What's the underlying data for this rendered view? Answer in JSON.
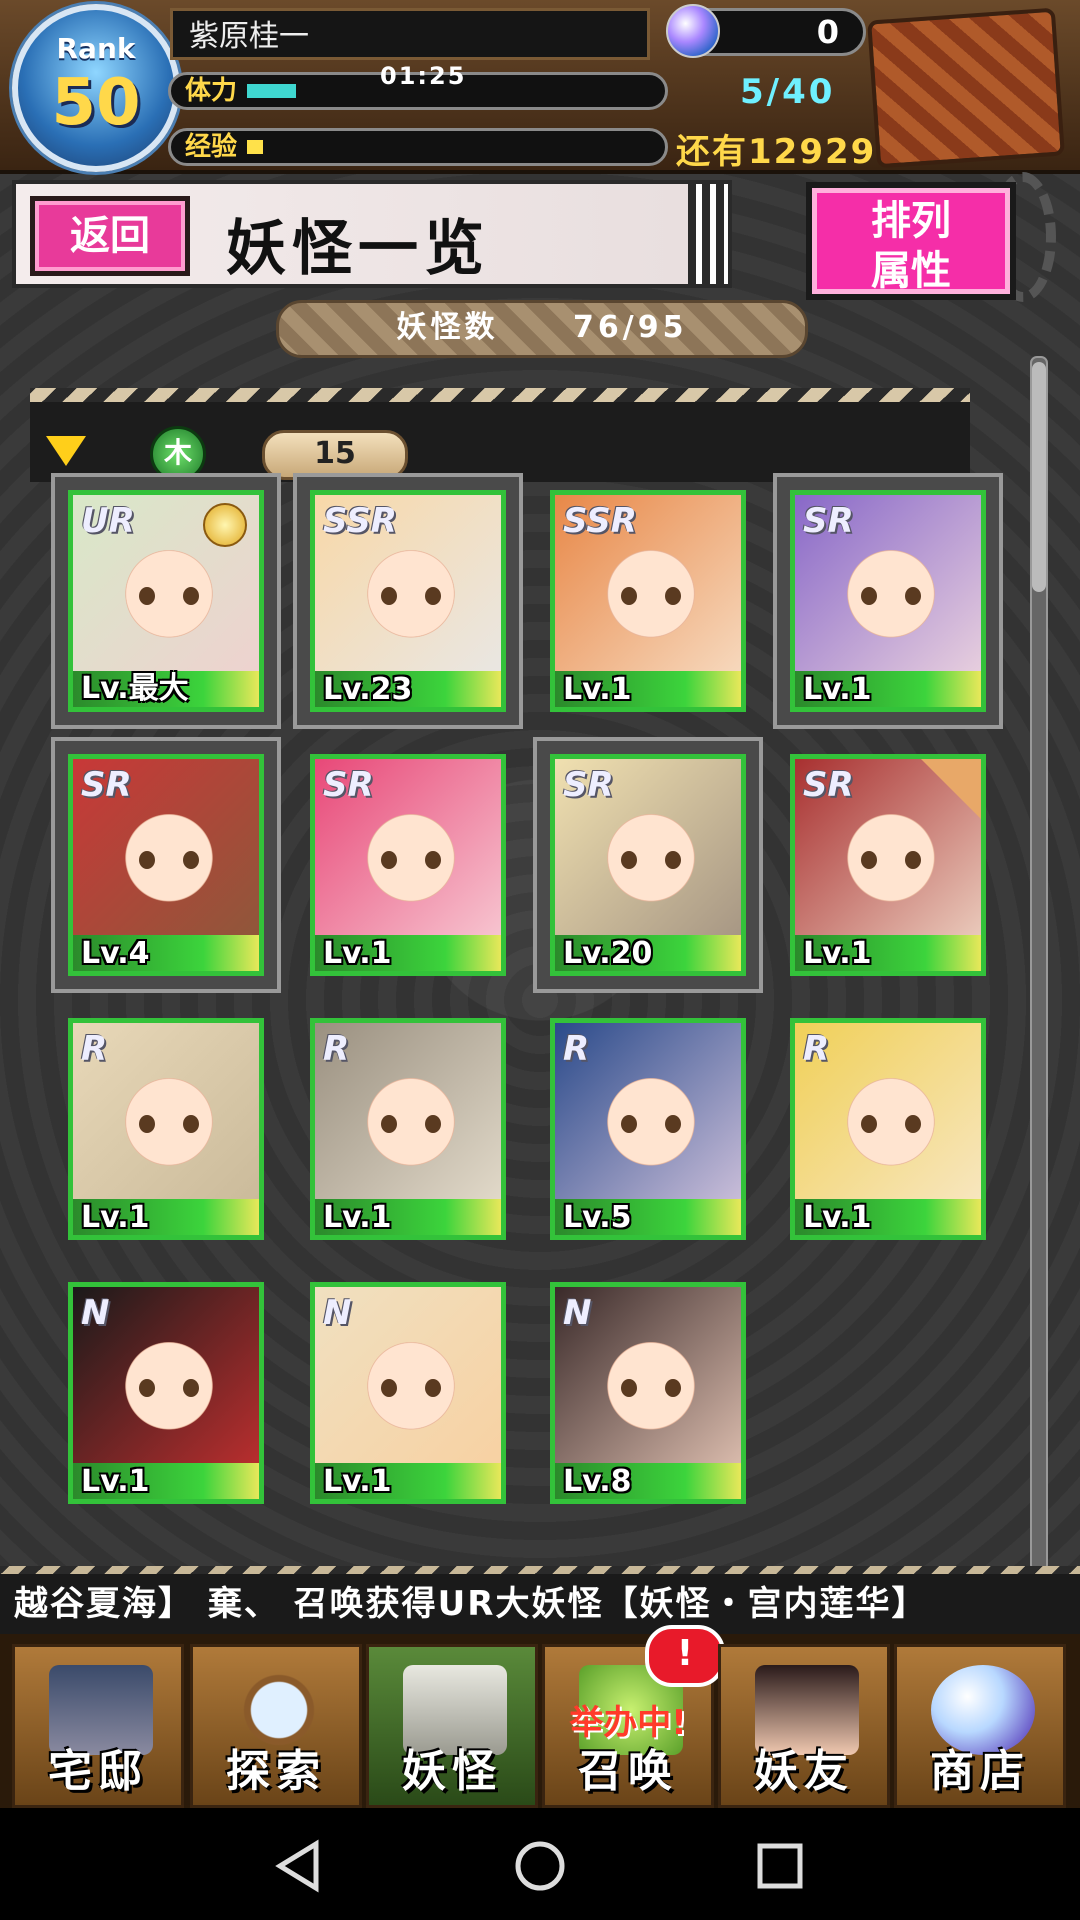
{
  "player": {
    "rank_label": "Rank",
    "rank_value": "50",
    "name": "紫原桂一",
    "stamina_label": "体力",
    "stamina_timer": "01:25",
    "stamina_value": "5/40",
    "stamina_fraction": 0.125,
    "exp_label": "经验",
    "exp_remaining": "还有12929",
    "exp_fraction": 0.03,
    "gems": "0"
  },
  "header": {
    "back_label": "返回",
    "page_title": "妖怪一览",
    "sort_line1": "排列",
    "sort_line2": "属性"
  },
  "summary": {
    "count_label": "妖怪数",
    "count_value": "76/95"
  },
  "filter": {
    "element_icon": "木",
    "count": "15"
  },
  "cards": [
    {
      "rarity": "UR",
      "level": "Lv.最大",
      "selected": true,
      "medal": true,
      "c1": "#d8e8c8",
      "c2": "#f0d0d0"
    },
    {
      "rarity": "SSR",
      "level": "Lv.23",
      "selected": true,
      "c1": "#f8d8a8",
      "c2": "#e8e8e8"
    },
    {
      "rarity": "SSR",
      "level": "Lv.1",
      "selected": false,
      "c1": "#e88848",
      "c2": "#f8e0c8"
    },
    {
      "rarity": "SR",
      "level": "Lv.1",
      "selected": true,
      "c1": "#8868c8",
      "c2": "#f0d8e0"
    },
    {
      "rarity": "SR",
      "level": "Lv.4",
      "selected": true,
      "c1": "#c83838",
      "c2": "#8a5a3a"
    },
    {
      "rarity": "SR",
      "level": "Lv.1",
      "selected": false,
      "c1": "#e84878",
      "c2": "#f8d0d8"
    },
    {
      "rarity": "SR",
      "level": "Lv.20",
      "selected": true,
      "c1": "#f0e0b0",
      "c2": "#a09080"
    },
    {
      "rarity": "SR",
      "level": "Lv.1",
      "selected": false,
      "star": true,
      "c1": "#a83030",
      "c2": "#f0d8c8"
    },
    {
      "rarity": "R",
      "level": "Lv.1",
      "selected": false,
      "c1": "#e8d8b8",
      "c2": "#c8b898"
    },
    {
      "rarity": "R",
      "level": "Lv.1",
      "selected": false,
      "c1": "#9a9080",
      "c2": "#e8e0d0"
    },
    {
      "rarity": "R",
      "level": "Lv.5",
      "selected": false,
      "c1": "#2a4a8a",
      "c2": "#d8c8e0"
    },
    {
      "rarity": "R",
      "level": "Lv.1",
      "selected": false,
      "c1": "#f0d058",
      "c2": "#f8e8c8"
    },
    {
      "rarity": "N",
      "level": "Lv.1",
      "selected": false,
      "c1": "#1a1a1a",
      "c2": "#c83030"
    },
    {
      "rarity": "N",
      "level": "Lv.1",
      "selected": false,
      "c1": "#f0e0c0",
      "c2": "#f8d0a0"
    },
    {
      "rarity": "N",
      "level": "Lv.8",
      "selected": false,
      "c1": "#3a2a2a",
      "c2": "#e8c8b8"
    }
  ],
  "ticker": "越谷夏海】     棄、 召唤获得UR大妖怪【妖怪・宫内莲华】",
  "nav": {
    "home": "宅邸",
    "explore": "探索",
    "youkai": "妖怪",
    "summon": "召唤",
    "summon_event": "举办中!",
    "summon_alert": "!",
    "friends": "妖友",
    "shop": "商店"
  },
  "colors": {
    "accent_pink": "#f52ea8",
    "card_border_green": "#33c23a",
    "stamina_cyan": "#3fd7d0",
    "gold": "#ffd84a"
  },
  "icons": {
    "back": "triangle-back-icon",
    "home": "circle-home-icon",
    "recents": "square-recents-icon"
  }
}
